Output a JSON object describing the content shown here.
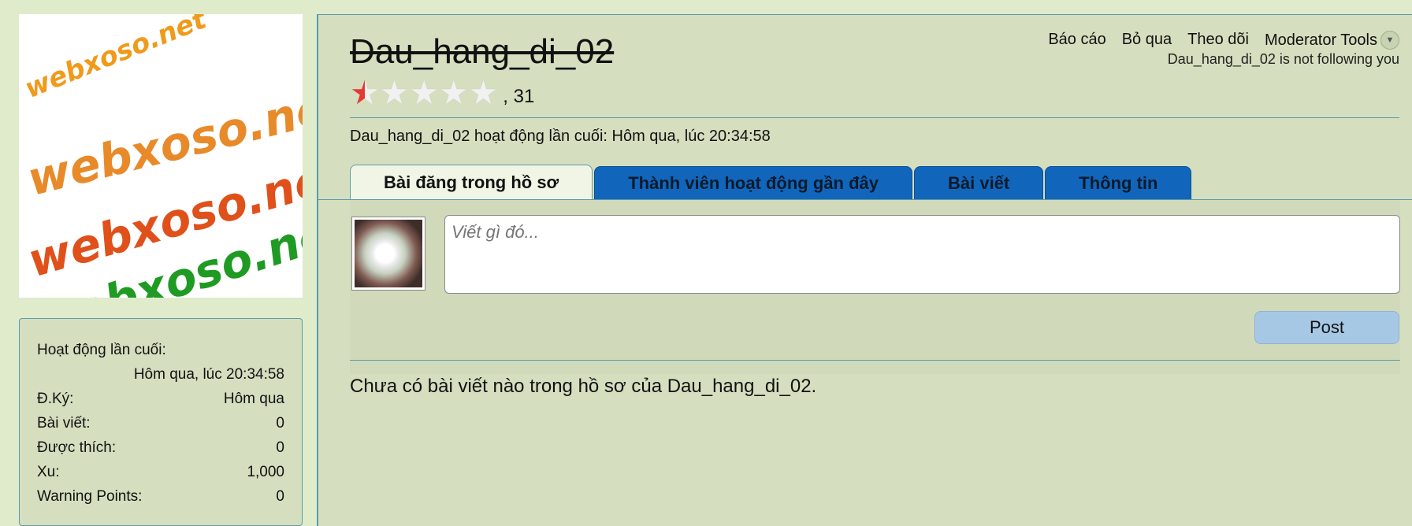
{
  "logo": {
    "lines": [
      "webxoso.net",
      "webxoso.net",
      "webxoso.net",
      "webxoso.net"
    ]
  },
  "profile": {
    "username": "Dau_hang_di_02",
    "rating_count": ", 31",
    "rating_stars": 0.5,
    "rating_max": 5,
    "last_active_line": "Dau_hang_di_02 hoạt động lần cuối: Hôm qua, lúc 20:34:58",
    "follow_note": "Dau_hang_di_02 is not following you"
  },
  "top_links": [
    "Báo cáo",
    "Bỏ qua",
    "Theo dõi",
    "Moderator Tools"
  ],
  "tabs": [
    "Bài đăng trong hồ sơ",
    "Thành viên hoạt động gần đây",
    "Bài viết",
    "Thông tin"
  ],
  "composer": {
    "placeholder": "Viết gì đó...",
    "post_label": "Post"
  },
  "empty_message": "Chưa có bài viết nào trong hồ sơ của Dau_hang_di_02.",
  "stats": {
    "last_active_label": "Hoạt động lần cuối:",
    "last_active_value": "Hôm qua, lúc 20:34:58",
    "rows": [
      {
        "label": "Đ.Ký:",
        "value": "Hôm qua"
      },
      {
        "label": "Bài viết:",
        "value": "0"
      },
      {
        "label": "Được thích:",
        "value": "0"
      },
      {
        "label": "Xu:",
        "value": "1,000"
      },
      {
        "label": "Warning Points:",
        "value": "0"
      }
    ]
  },
  "colors": {
    "background": "#e0ebcc",
    "panel": "#d5dfbf",
    "tab": "#1166bb",
    "accent_border": "#5b9aaa"
  }
}
